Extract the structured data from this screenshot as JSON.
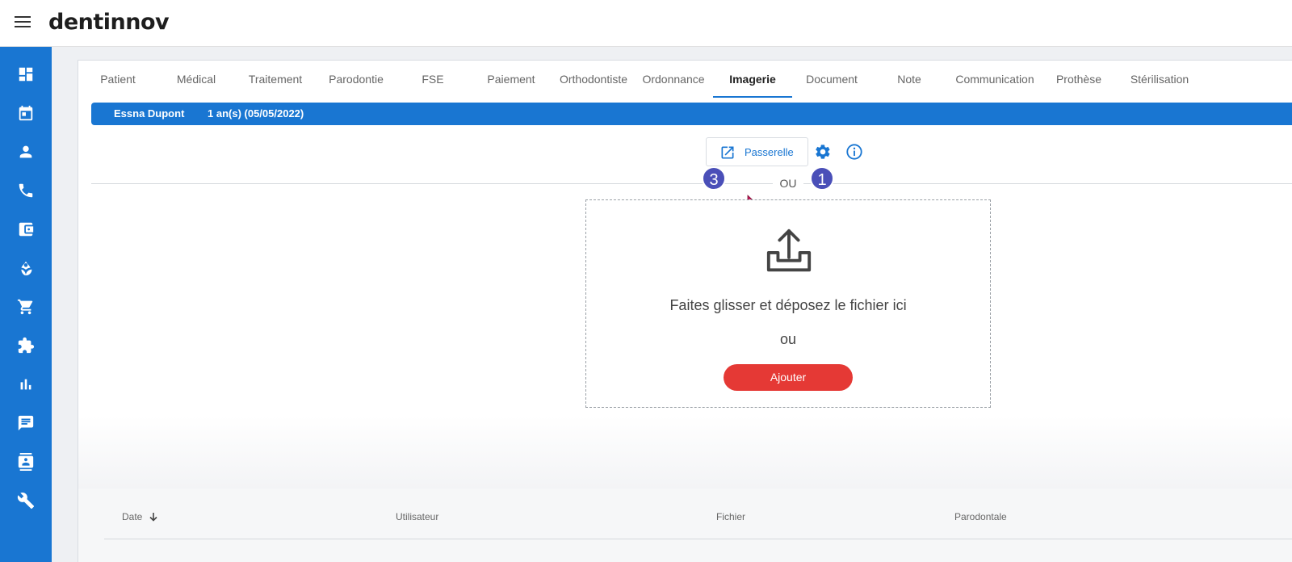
{
  "app": {
    "logo": "dentinnov"
  },
  "sidebar": {
    "items": [
      {
        "icon": "dashboard-icon"
      },
      {
        "icon": "calendar-icon"
      },
      {
        "icon": "person-icon"
      },
      {
        "icon": "phone-icon"
      },
      {
        "icon": "wallet-icon"
      },
      {
        "icon": "spa-icon"
      },
      {
        "icon": "cart-icon"
      },
      {
        "icon": "puzzle-icon"
      },
      {
        "icon": "bar-chart-icon"
      },
      {
        "icon": "chat-icon"
      },
      {
        "icon": "contact-card-icon"
      },
      {
        "icon": "wrench-icon"
      }
    ]
  },
  "tabs": [
    {
      "label": "Patient"
    },
    {
      "label": "Médical"
    },
    {
      "label": "Traitement"
    },
    {
      "label": "Parodontie"
    },
    {
      "label": "FSE"
    },
    {
      "label": "Paiement"
    },
    {
      "label": "Orthodontiste"
    },
    {
      "label": "Ordonnance"
    },
    {
      "label": "Imagerie",
      "active": true
    },
    {
      "label": "Document"
    },
    {
      "label": "Note"
    },
    {
      "label": "Communication"
    },
    {
      "label": "Prothèse"
    },
    {
      "label": "Stérilisation"
    }
  ],
  "patient": {
    "name": "Essna Dupont",
    "age": "1 an(s)  (05/05/2022)"
  },
  "toolbar": {
    "passerelle_label": "Passerelle",
    "or_label": "OU",
    "badge_left": "3",
    "badge_right": "1"
  },
  "dropzone": {
    "text": "Faites glisser et déposez le fichier ici",
    "or": "ou",
    "add_label": "Ajouter"
  },
  "table": {
    "columns": [
      {
        "label": "Date"
      },
      {
        "label": "Utilisateur"
      },
      {
        "label": "Fichier"
      },
      {
        "label": "Parodontale"
      }
    ]
  },
  "colors": {
    "primary": "#1976d2",
    "accent_red": "#e53935",
    "badge": "#4a4fb8"
  }
}
